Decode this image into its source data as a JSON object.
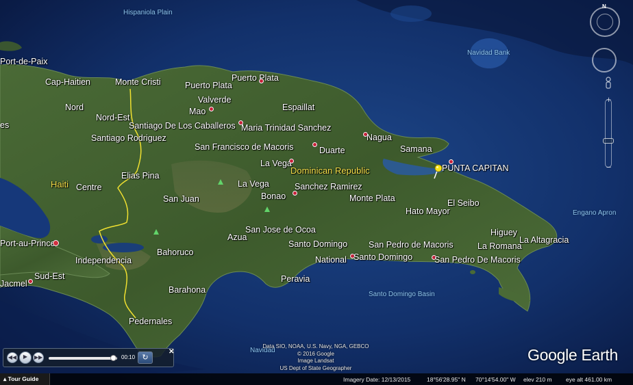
{
  "map": {
    "app": "Google Earth",
    "logo_text": "Google Earth",
    "pushpin": {
      "label": "PUNTA CAPITAN",
      "icon": "yellow-pushpin-icon"
    },
    "countries": [
      {
        "name": "Haiti"
      },
      {
        "name": "Dominican Republic"
      }
    ],
    "water_labels": [
      {
        "name": "Hispaniola Plain"
      },
      {
        "name": "Navidad Bank"
      },
      {
        "name": "Engano Apron"
      },
      {
        "name": "Santo Domingo Basin"
      },
      {
        "name": "Navidad"
      }
    ],
    "places": [
      {
        "name": "Port-de-Paix"
      },
      {
        "name": "Cap-Haitien"
      },
      {
        "name": "Monte Cristi"
      },
      {
        "name": "Puerto Plata"
      },
      {
        "name": "Puerto Plata"
      },
      {
        "name": "Valverde"
      },
      {
        "name": "Mao"
      },
      {
        "name": "Espaillat"
      },
      {
        "name": "Nord"
      },
      {
        "name": "Nord-Est"
      },
      {
        "name": "Santiago De Los Caballeros"
      },
      {
        "name": "Maria Trinidad Sanchez"
      },
      {
        "name": "Nagua"
      },
      {
        "name": "Santiago Rodriguez"
      },
      {
        "name": "San Francisco de Macoris"
      },
      {
        "name": "Duarte"
      },
      {
        "name": "Samana"
      },
      {
        "name": "La Vega"
      },
      {
        "name": "Elias Pina"
      },
      {
        "name": "Centre"
      },
      {
        "name": "La Vega"
      },
      {
        "name": "Sanchez Ramirez"
      },
      {
        "name": "Bonao"
      },
      {
        "name": "Monte Plata"
      },
      {
        "name": "El Seibo"
      },
      {
        "name": "San Juan"
      },
      {
        "name": "Hato Mayor"
      },
      {
        "name": "San Jose de Ocoa"
      },
      {
        "name": "Azua"
      },
      {
        "name": "Higuey"
      },
      {
        "name": "La Altagracia"
      },
      {
        "name": "Santo Domingo"
      },
      {
        "name": "San Pedro de Macoris"
      },
      {
        "name": "La Romana"
      },
      {
        "name": "Port-au-Prince"
      },
      {
        "name": "Bahoruco"
      },
      {
        "name": "Independencia"
      },
      {
        "name": "National"
      },
      {
        "name": "Santo Domingo"
      },
      {
        "name": "San Pedro De Macoris"
      },
      {
        "name": "Sud-Est"
      },
      {
        "name": "Jacmel"
      },
      {
        "name": "Peravia"
      },
      {
        "name": "Barahona"
      },
      {
        "name": "Pedernales"
      },
      {
        "name": "es"
      }
    ],
    "attribution": [
      "Data SIO, NOAA, U.S. Navy, NGA, GEBCO",
      "© 2016 Google",
      "Image Landsat",
      "US Dept of State Geographer"
    ]
  },
  "tour": {
    "tab_label": "Tour Guide",
    "time": "00:10",
    "progress": 0.95
  },
  "status": {
    "imagery_date": "Imagery Date: 12/13/2015",
    "lat": "18°56'28.95\" N",
    "lon": "70°14'54.00\" W",
    "elev": "elev  210 m",
    "eye_alt": "eye alt 461.00 km"
  },
  "nav": {
    "north_label": "N"
  },
  "colors": {
    "ocean_deep": "#0a1d4a",
    "ocean_shallow": "#1e4a8a",
    "land": "#3f5a2e",
    "border": "#f0e030",
    "country_label": "#f5e04a",
    "water_label": "#8fc2e8"
  }
}
